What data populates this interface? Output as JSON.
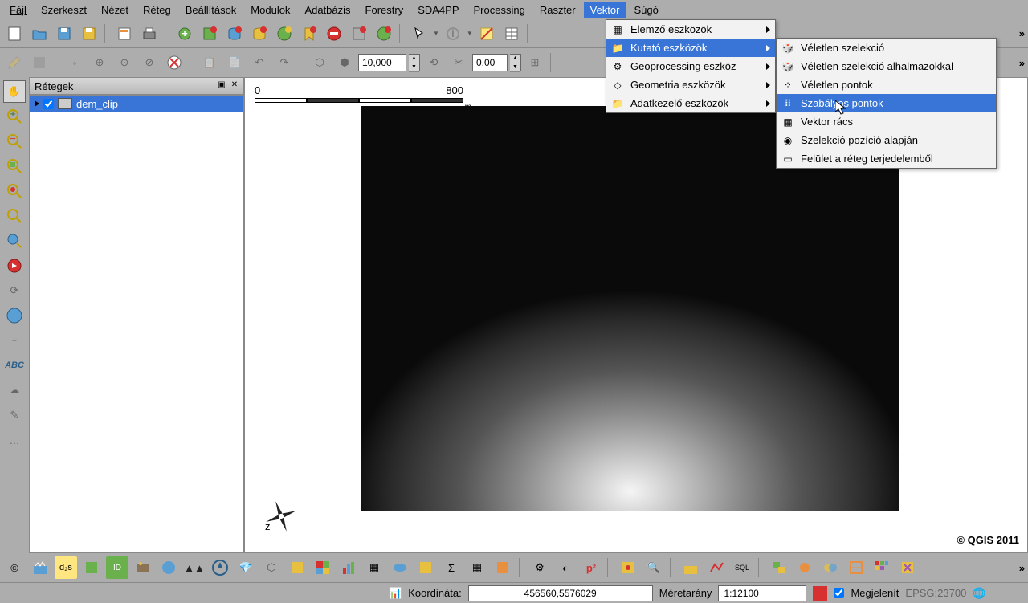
{
  "menubar": [
    "Fájl",
    "Szerkeszt",
    "Nézet",
    "Réteg",
    "Beállítások",
    "Modulok",
    "Adatbázis",
    "Forestry",
    "SDA4PP",
    "Processing",
    "Raszter",
    "Vektor",
    "Súgó"
  ],
  "menubar_highlighted": 11,
  "toolbar2": {
    "input1": "10,000",
    "input2": "0,00"
  },
  "layers_panel": {
    "title": "Rétegek",
    "layer1": "dem_clip"
  },
  "scale": {
    "start": "0",
    "end": "800",
    "unit": "m"
  },
  "credit": "© QGIS 2011",
  "dropdown1": {
    "items": [
      {
        "label": "Elemző eszközök",
        "arrow": true
      },
      {
        "label": "Kutató eszközök",
        "arrow": true,
        "highlighted": true
      },
      {
        "label": "Geoprocessing eszköz",
        "arrow": true
      },
      {
        "label": "Geometria eszközök",
        "arrow": true
      },
      {
        "label": "Adatkezelő eszközök",
        "arrow": true
      }
    ]
  },
  "dropdown2": {
    "items": [
      {
        "label": "Véletlen szelekció"
      },
      {
        "label": "Véletlen szelekció alhalmazokkal"
      },
      {
        "label": "Véletlen pontok"
      },
      {
        "label": "Szabályos pontok",
        "highlighted": true
      },
      {
        "label": "Vektor rács"
      },
      {
        "label": "Szelekció pozíció alapján"
      },
      {
        "label": "Felület a réteg terjedelemből"
      }
    ]
  },
  "statusbar": {
    "coord_label": "Koordináta:",
    "coord_value": "456560,5576029",
    "scale_label": "Méretarány",
    "scale_value": "1:12100",
    "render_label": "Megjelenít",
    "crs": "EPSG:23700"
  }
}
